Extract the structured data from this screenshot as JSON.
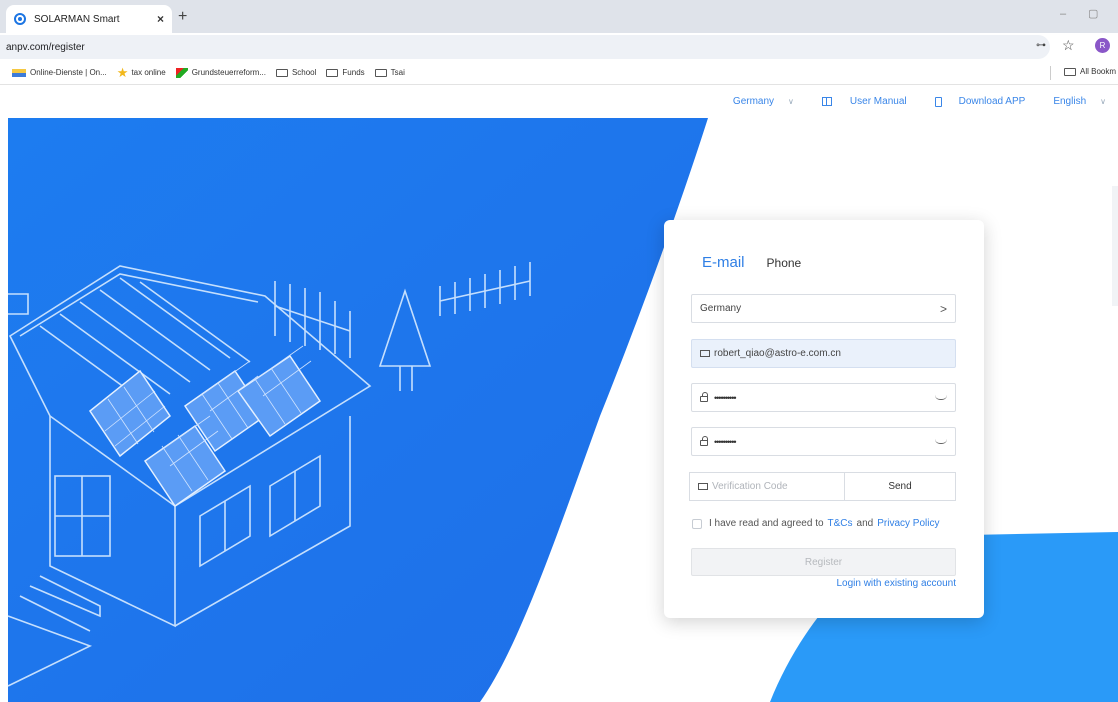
{
  "browser": {
    "tab_title": "SOLARMAN Smart",
    "tab_close": "×",
    "new_tab": "+",
    "url": "anpv.com/register",
    "window_min": "–",
    "window_max": "▢",
    "profile_initial": "R",
    "bookmarks": [
      {
        "label": "Online-Dienste | On...",
        "icon": "finanzamt-icon"
      },
      {
        "label": "tax online",
        "icon": "star-icon"
      },
      {
        "label": "Grundsteuerreform...",
        "icon": "nrw-icon"
      },
      {
        "label": "School",
        "icon": "folder-icon"
      },
      {
        "label": "Funds",
        "icon": "folder-icon"
      },
      {
        "label": "Tsai",
        "icon": "folder-icon"
      }
    ],
    "all_bookmarks": "All Bookm"
  },
  "topnav": {
    "region": "Germany",
    "user_manual": "User Manual",
    "download_app": "Download APP",
    "language": "English"
  },
  "form": {
    "tab_email": "E-mail",
    "tab_phone": "Phone",
    "country": "Germany",
    "email": "robert_qiao@astro-e.com.cn",
    "password": "••••••••••",
    "confirm_password": "••••••••••",
    "verification_placeholder": "Verification Code",
    "send_label": "Send",
    "agree_text": "I have read and agreed to",
    "tcs_link": "T&Cs",
    "and_text": "and",
    "privacy_link": "Privacy Policy",
    "register_label": "Register",
    "login_link": "Login with existing account"
  },
  "colors": {
    "brand_blue": "#1f7ff0",
    "link_blue": "#2f7fe5"
  }
}
